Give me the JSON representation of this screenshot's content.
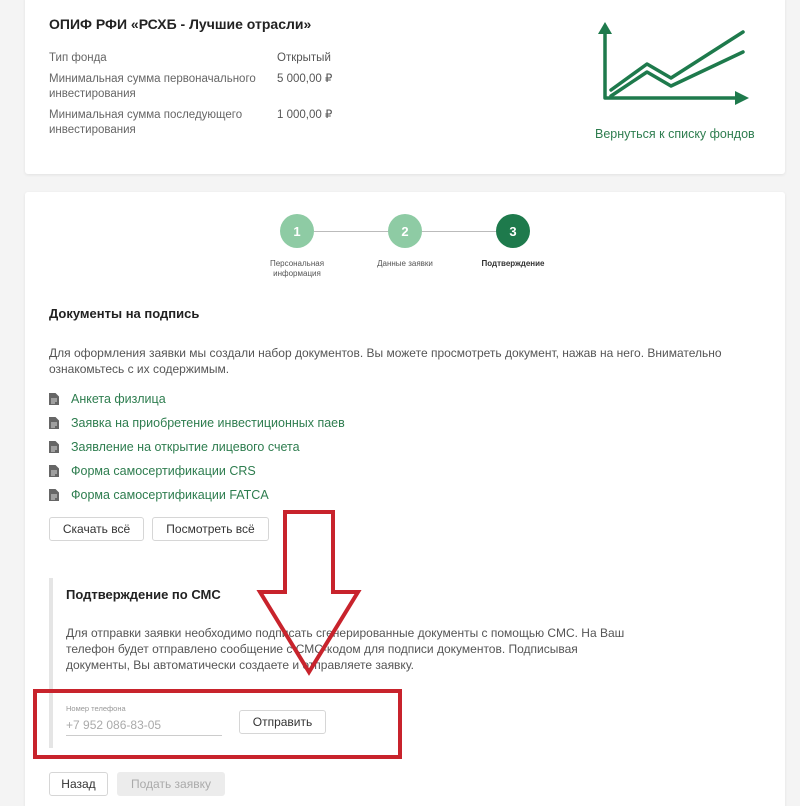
{
  "fund": {
    "title": "ОПИФ РФИ «РСХБ - Лучшие отрасли»",
    "rows": [
      {
        "label": "Тип фонда",
        "value": "Открытый"
      },
      {
        "label": "Минимальная сумма первоначального инвестирования",
        "value": "5 000,00 ₽"
      },
      {
        "label": "Минимальная сумма последующего инвестирования",
        "value": "1 000,00 ₽"
      }
    ],
    "back_link": "Вернуться к списку фондов",
    "chart_icon": "growth-chart-icon"
  },
  "steps": [
    {
      "number": "1",
      "label": "Персональная информация",
      "state": "done"
    },
    {
      "number": "2",
      "label": "Данные заявки",
      "state": "done"
    },
    {
      "number": "3",
      "label": "Подтверждение",
      "state": "active"
    }
  ],
  "documents": {
    "title": "Документы на подпись",
    "description": "Для оформления заявки мы создали набор документов. Вы можете просмотреть документ, нажав на него. Внимательно ознакомьтесь с их содержимым.",
    "items": [
      "Анкета физлица",
      "Заявка на приобретение инвестиционных паев",
      "Заявление на открытие лицевого счета",
      "Форма самосертификации CRS",
      "Форма самосертификации FATCA"
    ],
    "download_all": "Скачать всё",
    "view_all": "Посмотреть всё"
  },
  "sms": {
    "title": "Подтверждение по СМС",
    "description": "Для отправки заявки необходимо подписать сгенерированные документы с помощью СМС. На Ваш телефон будет отправлено сообщение с СМС-кодом для подписи документов. Подписывая документы, Вы автоматически создаете и отправляете заявку.",
    "phone_label": "Номер телефона",
    "phone_value": "+7 952 086-83-05",
    "send_button": "Отправить"
  },
  "footer": {
    "back_button": "Назад",
    "submit_button": "Подать заявку"
  },
  "colors": {
    "brand_green": "#1e7a4c",
    "link_green": "#2e7d4f",
    "step_done": "#8ecba4",
    "annotation_red": "#c8232c"
  }
}
